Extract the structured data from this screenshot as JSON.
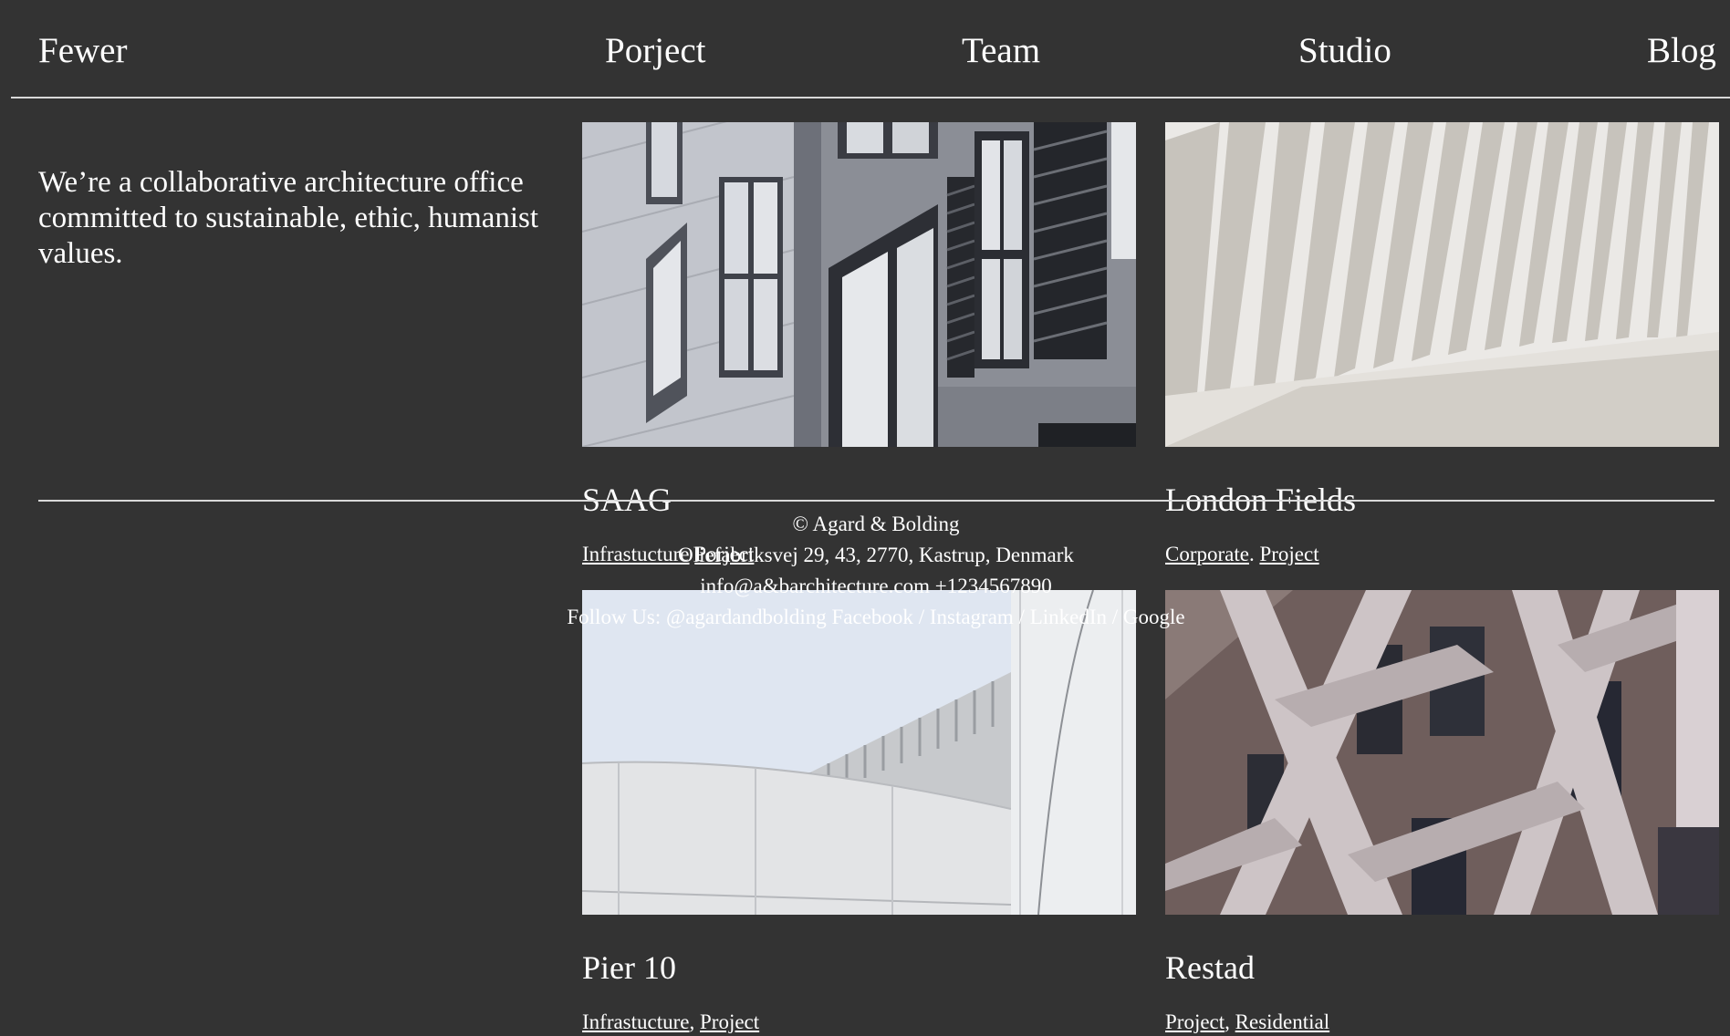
{
  "nav": {
    "logo": "Fewer",
    "items": [
      "Porject",
      "Team",
      "Studio",
      "Blog"
    ]
  },
  "intro": {
    "text": "We’re a collaborative architecture office committed to sustainable, ethic, humanist values."
  },
  "projects": [
    {
      "title": "SAAG",
      "tags": [
        "Infrastucture",
        "Porject"
      ],
      "image": "facade-windows-photo"
    },
    {
      "title": "London Fields",
      "tags": [
        "Corporate",
        "Project"
      ],
      "image": "white-slats-photo"
    },
    {
      "title": "Pier 10",
      "tags": [
        "Infrastucture",
        "Project"
      ],
      "image": "white-curved-building-photo"
    },
    {
      "title": "Restad",
      "tags": [
        "Project",
        "Residential"
      ],
      "image": "brown-diagonal-facade-photo"
    }
  ],
  "footer": {
    "copyright": "© Agard & Bolding",
    "address": "Oliefabriksvej 29, 43, 2770, Kastrup, Denmark",
    "contact": "info@a&barchitecture.com +1234567890",
    "follow_label": "Follow Us: @agardandbolding",
    "links": [
      "Facebook",
      "Instagram",
      "LinkedIn",
      "Google"
    ],
    "separator": "/"
  },
  "colors": {
    "background": "#333333",
    "text": "#ffffff",
    "rule": "#d9d9d9"
  }
}
